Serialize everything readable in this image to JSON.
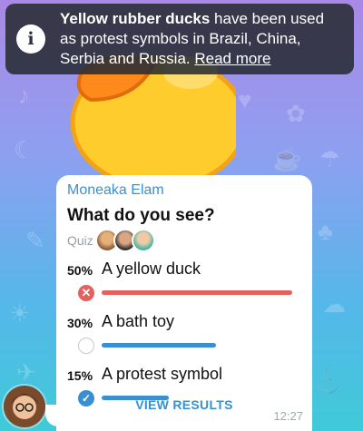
{
  "banner": {
    "bold_text": "Yellow rubber ducks",
    "text": " have been used as protest symbols in Brazil, China, Serbia and Russia. ",
    "link": "Read more"
  },
  "poll": {
    "sender": "Moneaka Elam",
    "question": "What do you see?",
    "type_label": "Quiz",
    "options": [
      {
        "percent": "50%",
        "text": "A yellow duck",
        "state": "wrong",
        "fraction": 1.0,
        "bar_color": "#e3625f"
      },
      {
        "percent": "30%",
        "text": "A bath toy",
        "state": "none",
        "fraction": 0.6,
        "bar_color": "#3a8fd1"
      },
      {
        "percent": "15%",
        "text": "A protest symbol",
        "state": "correct",
        "fraction": 0.35,
        "bar_color": "#3a8fd1"
      }
    ],
    "action": "VIEW RESULTS",
    "time": "12:27"
  },
  "colors": {
    "accent": "#3a8fd1",
    "wrong": "#e3625f"
  },
  "icons": [
    "info-icon",
    "cross-icon",
    "check-icon"
  ]
}
